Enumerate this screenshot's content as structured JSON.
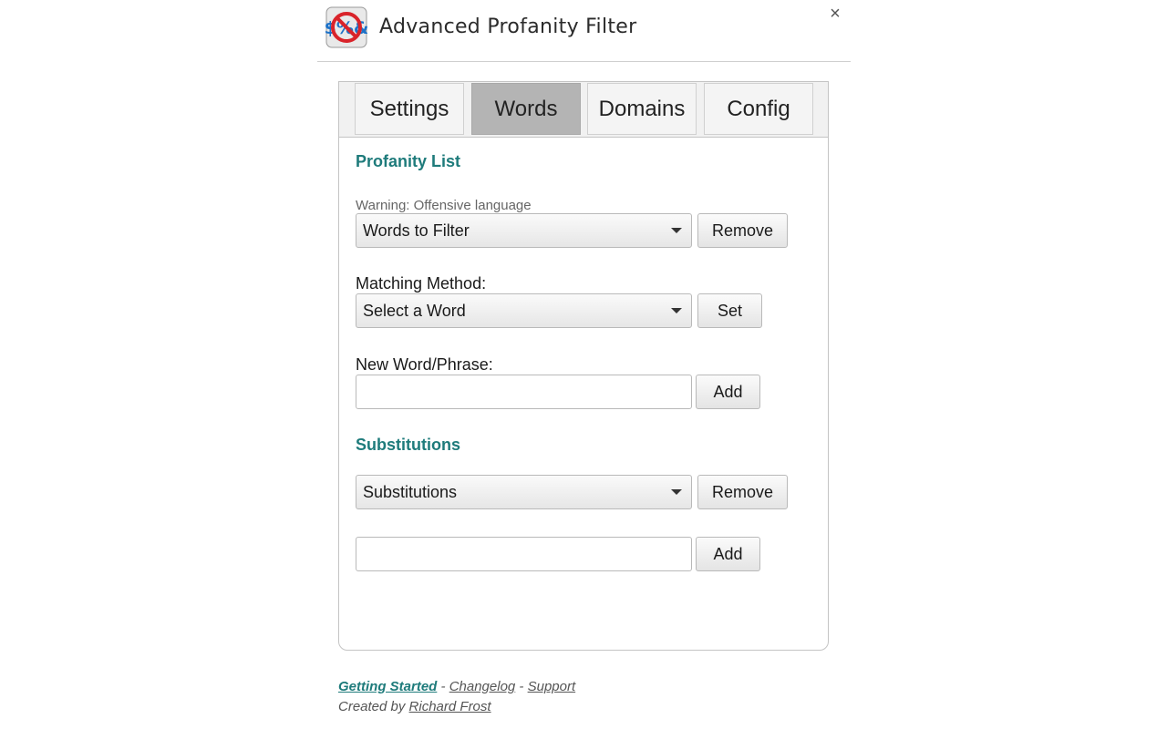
{
  "app": {
    "title": "Advanced Profanity Filter",
    "close_label": "×",
    "logo_icon": "profanity-filter-logo-icon"
  },
  "tabs": [
    {
      "label": "Settings",
      "active": false
    },
    {
      "label": "Words",
      "active": true
    },
    {
      "label": "Domains",
      "active": false
    },
    {
      "label": "Config",
      "active": false
    }
  ],
  "profanity": {
    "section_title": "Profanity List",
    "warning": "Warning: Offensive language",
    "words_select_value": "Words to Filter",
    "remove_label": "Remove",
    "matching_label": "Matching Method:",
    "matching_select_value": "Select a Word",
    "set_label": "Set",
    "new_word_label": "New Word/Phrase:",
    "new_word_value": "",
    "add_label": "Add"
  },
  "substitutions": {
    "section_title": "Substitutions",
    "select_value": "Substitutions",
    "remove_label": "Remove",
    "input_value": "",
    "add_label": "Add"
  },
  "footer": {
    "getting_started": "Getting Started",
    "sep1": " - ",
    "changelog": "Changelog",
    "sep2": " - ",
    "support": "Support",
    "created_by": "Created by ",
    "author": "Richard Frost"
  },
  "colors": {
    "accent": "#1e7b7b",
    "active_tab": "#b4b4b4"
  }
}
